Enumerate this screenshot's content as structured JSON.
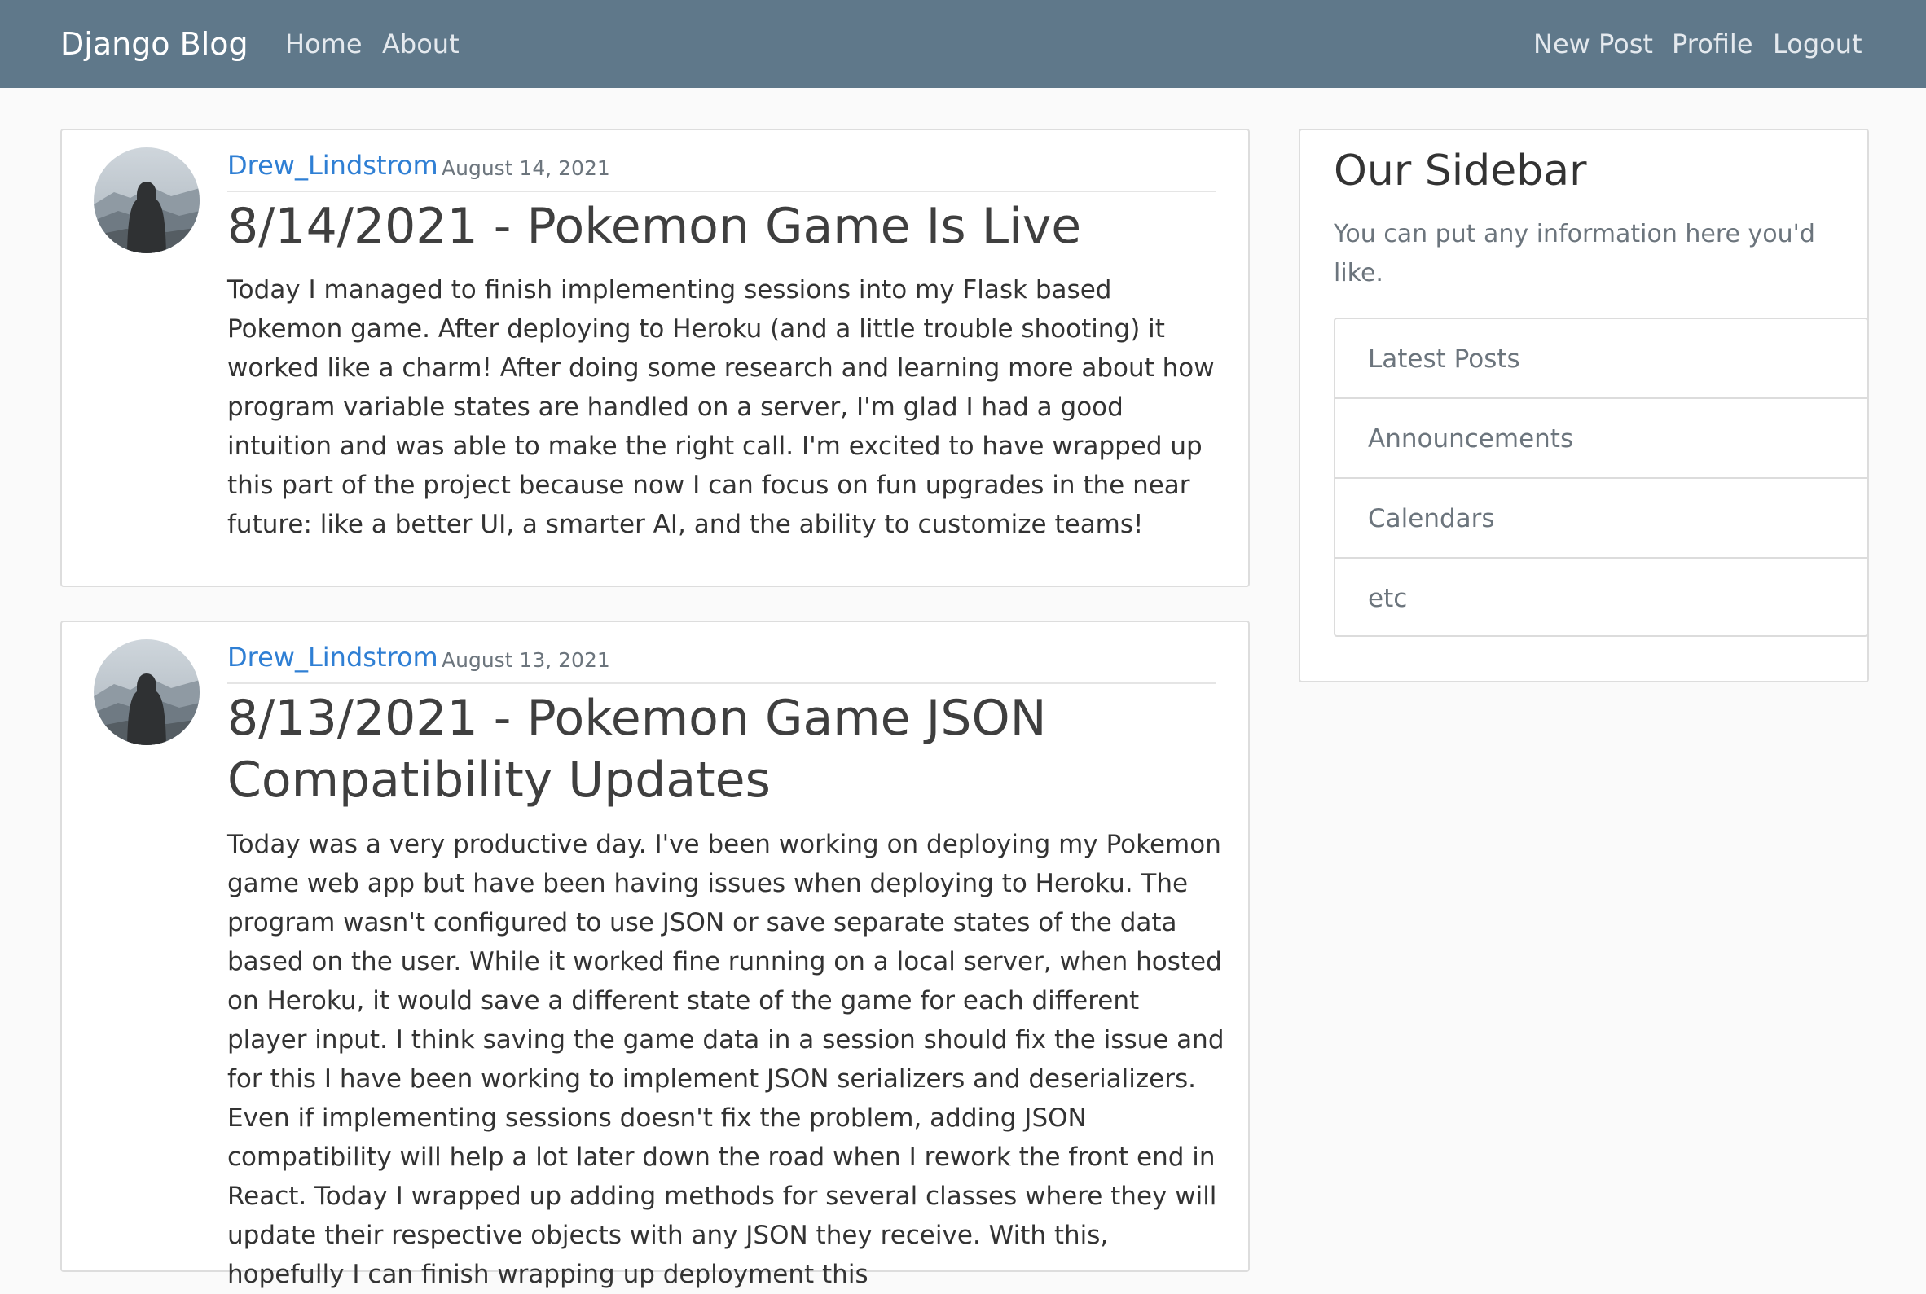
{
  "nav": {
    "brand": "Django Blog",
    "left_links": [
      "Home",
      "About"
    ],
    "right_links": [
      "New Post",
      "Profile",
      "Logout"
    ]
  },
  "posts": [
    {
      "author": "Drew_Lindstrom",
      "date": "August 14, 2021",
      "title": "8/14/2021 - Pokemon Game Is Live",
      "content": "Today I managed to finish implementing sessions into my Flask based Pokemon game. After deploying to Heroku (and a little trouble shooting) it worked like a charm! After doing some research and learning more about how program variable states are handled on a server, I'm glad I had a good intuition and was able to make the right call. I'm excited to have wrapped up this part of the project because now I can focus on fun upgrades in the near future: like a better UI, a smarter AI, and the ability to customize teams!"
    },
    {
      "author": "Drew_Lindstrom",
      "date": "August 13, 2021",
      "title": "8/13/2021 - Pokemon Game JSON Compatibility Updates",
      "content": "Today was a very productive day. I've been working on deploying my Pokemon game web app but have been having issues when deploying to Heroku. The program wasn't configured to use JSON or save separate states of the data based on the user. While it worked fine running on a local server, when hosted on Heroku, it would save a different state of the game for each different player input. I think saving the game data in a session should fix the issue and for this I have been working to implement JSON serializers and deserializers. Even if implementing sessions doesn't fix the problem, adding JSON compatibility will help a lot later down the road when I rework the front end in React. Today I wrapped up adding methods for several classes where they will update their respective objects with any JSON they receive. With this, hopefully I can finish wrapping up deployment this"
    }
  ],
  "sidebar": {
    "title": "Our Sidebar",
    "text": "You can put any information here you'd like.",
    "items": [
      "Latest Posts",
      "Announcements",
      "Calendars",
      "etc"
    ]
  },
  "colors": {
    "navbar": "#5f788a",
    "link": "#2f7fd4",
    "page_background": "#fafafa"
  },
  "icons": {
    "avatar": "hooded-figure-avatar"
  }
}
